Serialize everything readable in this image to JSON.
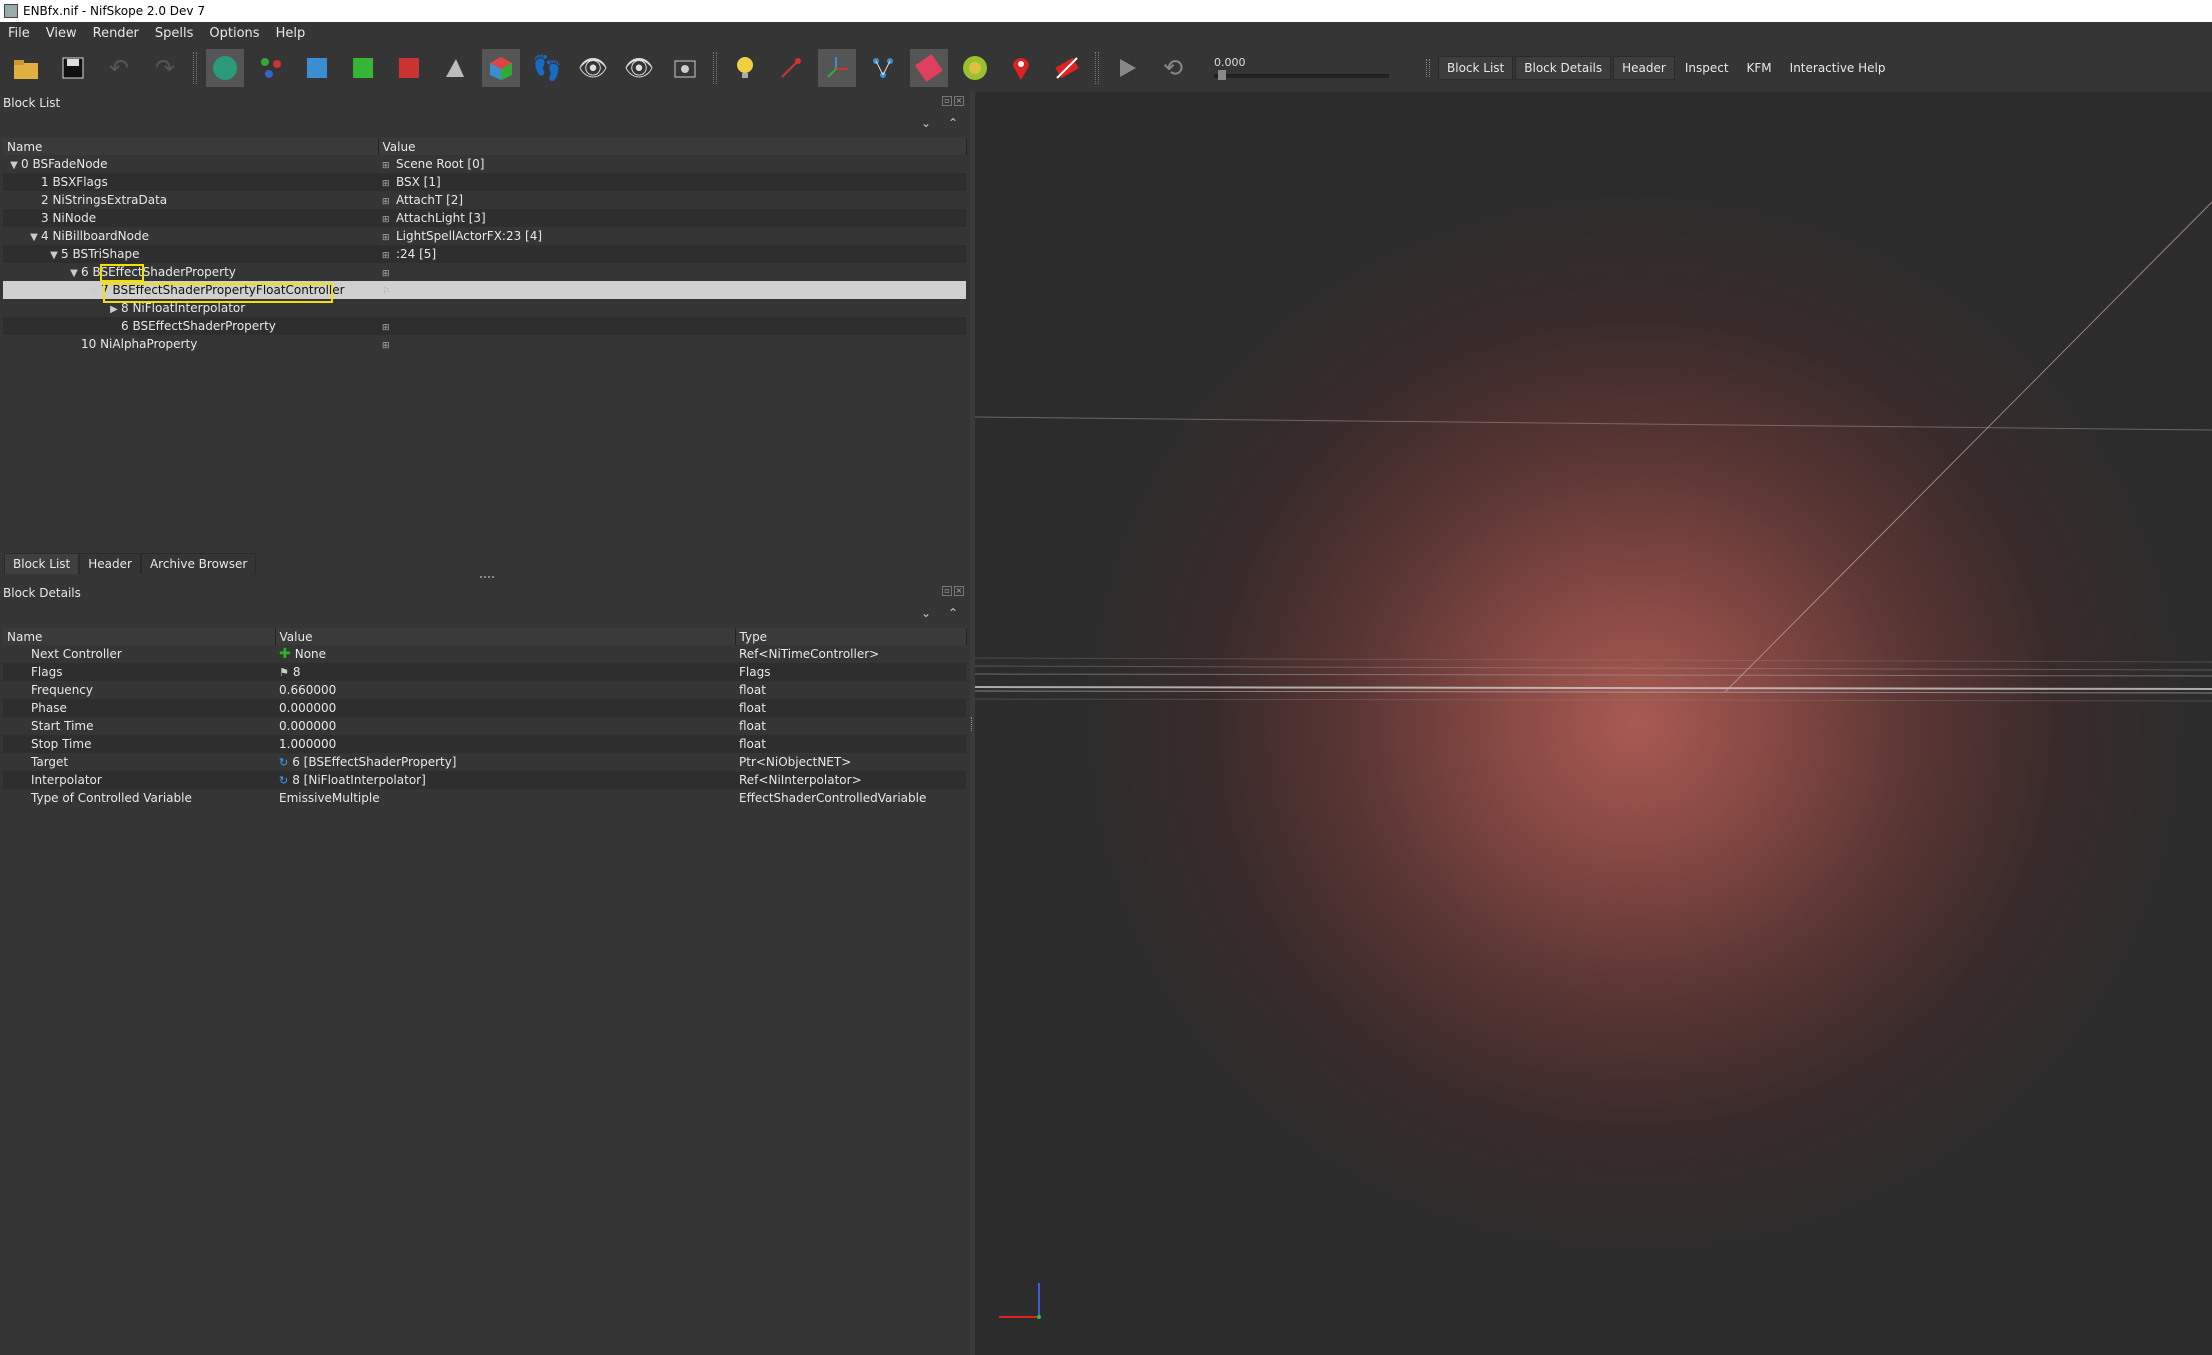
{
  "window": {
    "title": "ENBfx.nif - NifSkope 2.0 Dev 7"
  },
  "menu": [
    "File",
    "View",
    "Render",
    "Spells",
    "Options",
    "Help"
  ],
  "toolbar": {
    "icons": [
      "load-icon",
      "save-icon",
      "undo-icon",
      "redo-icon",
      "select-object-icon",
      "select-vertex-icon",
      "view-top-icon",
      "view-front-icon",
      "view-side-icon",
      "user-view-icon",
      "flip-view-icon",
      "orthographic-icon",
      "walk-icon",
      "show-hidden-icon",
      "show-hidden-sel-icon",
      "screenshot-icon",
      "lighting-icon",
      "select-node-icon",
      "axes-icon",
      "connect-nodes-icon",
      "mesh-colors-icon",
      "textures-icon",
      "markers-icon",
      "hide-collision-icon",
      "play-icon",
      "loop-icon"
    ],
    "anim_time": "0.000",
    "tabs": [
      {
        "label": "Block List",
        "active": true
      },
      {
        "label": "Block Details",
        "active": true
      },
      {
        "label": "Header",
        "active": true
      },
      {
        "label": "Inspect",
        "active": false
      },
      {
        "label": "KFM",
        "active": false
      },
      {
        "label": "Interactive Help",
        "active": false
      }
    ]
  },
  "block_list": {
    "title": "Block List",
    "columns": [
      "Name",
      "Value"
    ],
    "rows": [
      {
        "name": "0 BSFadeNode",
        "value": "Scene Root [0]",
        "indent": 0,
        "arrow": "down",
        "value_icon": true
      },
      {
        "name": "1 BSXFlags",
        "value": "BSX [1]",
        "indent": 1,
        "arrow": "",
        "value_icon": true
      },
      {
        "name": "2 NiStringsExtraData",
        "value": "AttachT [2]",
        "indent": 1,
        "arrow": "",
        "value_icon": true
      },
      {
        "name": "3 NiNode",
        "value": "AttachLight [3]",
        "indent": 1,
        "arrow": "",
        "value_icon": true
      },
      {
        "name": "4 NiBillboardNode",
        "value": "LightSpellActorFX:23 [4]",
        "indent": 1,
        "arrow": "down",
        "value_icon": true
      },
      {
        "name": "5 BSTriShape",
        "value": ":24 [5]",
        "indent": 2,
        "arrow": "down",
        "value_icon": true
      },
      {
        "name": "6 BSEffectShaderProperty",
        "value": "",
        "indent": 3,
        "arrow": "down",
        "value_icon": true
      },
      {
        "name": "7 BSEffectShaderPropertyFloatController",
        "value": "",
        "indent": 4,
        "arrow": "down",
        "value_icon": true,
        "selected": true
      },
      {
        "name": "8 NiFloatInterpolator",
        "value": "",
        "indent": 5,
        "arrow": "right",
        "value_icon": false
      },
      {
        "name": "6 BSEffectShaderProperty",
        "value": "",
        "indent": 5,
        "arrow": "",
        "value_icon": true
      },
      {
        "name": "10 NiAlphaProperty",
        "value": "",
        "indent": 3,
        "arrow": "",
        "value_icon": true
      }
    ]
  },
  "bottom_tabs": [
    "Block List",
    "Header",
    "Archive Browser"
  ],
  "block_details": {
    "title": "Block Details",
    "columns": [
      "Name",
      "Value",
      "Type"
    ],
    "rows": [
      {
        "name": "Next Controller",
        "value": "None",
        "type": "Ref<NiTimeController>",
        "icon": "plus"
      },
      {
        "name": "Flags",
        "value": "8",
        "type": "Flags",
        "icon": "flag"
      },
      {
        "name": "Frequency",
        "value": "0.660000",
        "type": "float",
        "icon": ""
      },
      {
        "name": "Phase",
        "value": "0.000000",
        "type": "float",
        "icon": ""
      },
      {
        "name": "Start Time",
        "value": "0.000000",
        "type": "float",
        "icon": ""
      },
      {
        "name": "Stop Time",
        "value": "1.000000",
        "type": "float",
        "icon": ""
      },
      {
        "name": "Target",
        "value": "6 [BSEffectShaderProperty]",
        "type": "Ptr<NiObjectNET>",
        "icon": "link"
      },
      {
        "name": "Interpolator",
        "value": "8 [NiFloatInterpolator]",
        "type": "Ref<NiInterpolator>",
        "icon": "link"
      },
      {
        "name": "Type of Controlled Variable",
        "value": "EmissiveMultiple",
        "type": "EffectShaderControlledVariable",
        "icon": ""
      }
    ]
  },
  "colors": {
    "highlight": "#f2e000",
    "background": "#2b2b2b",
    "glow": "#a85a52"
  }
}
